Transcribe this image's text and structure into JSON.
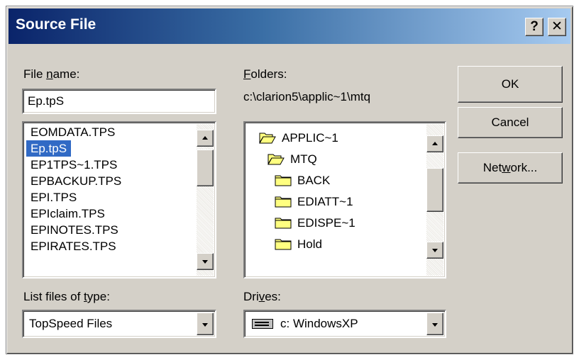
{
  "window": {
    "title": "Source File",
    "help_label": "?",
    "close_label": "✕"
  },
  "file_name": {
    "label_before": "File ",
    "label_accel": "n",
    "label_after": "ame:",
    "value": "Ep.tpS"
  },
  "files": {
    "items": [
      {
        "label": "EOMDATA.TPS",
        "selected": false
      },
      {
        "label": "Ep.tpS",
        "selected": true
      },
      {
        "label": "EP1TPS~1.TPS",
        "selected": false
      },
      {
        "label": "EPBACKUP.TPS",
        "selected": false
      },
      {
        "label": "EPI.TPS",
        "selected": false
      },
      {
        "label": "EPIclaim.TPS",
        "selected": false
      },
      {
        "label": "EPINOTES.TPS",
        "selected": false
      },
      {
        "label": "EPIRATES.TPS",
        "selected": false
      }
    ]
  },
  "folders": {
    "label_accel": "F",
    "label_after": "olders:",
    "current_path": "c:\\clarion5\\applic~1\\mtq",
    "items": [
      {
        "label": "APPLIC~1",
        "icon": "open-folder-icon"
      },
      {
        "label": "MTQ",
        "icon": "open-folder-icon"
      },
      {
        "label": "BACK",
        "icon": "folder-icon"
      },
      {
        "label": "EDIATT~1",
        "icon": "folder-icon"
      },
      {
        "label": "EDISPE~1",
        "icon": "folder-icon"
      },
      {
        "label": "Hold",
        "icon": "folder-icon"
      }
    ]
  },
  "buttons": {
    "ok": "OK",
    "cancel": "Cancel",
    "network_before": "Net",
    "network_accel": "w",
    "network_after": "ork..."
  },
  "file_type": {
    "label_before": "List files of ",
    "label_accel": "t",
    "label_after": "ype:",
    "value": "TopSpeed Files"
  },
  "drives": {
    "label_before": "Dri",
    "label_accel": "v",
    "label_after": "es:",
    "value": "c: WindowsXP",
    "icon": "drive-icon"
  },
  "colors": {
    "title_start": "#0a246a",
    "title_end": "#a6caf0",
    "selection": "#316ac5",
    "folder_yellow": "#ffff80"
  }
}
